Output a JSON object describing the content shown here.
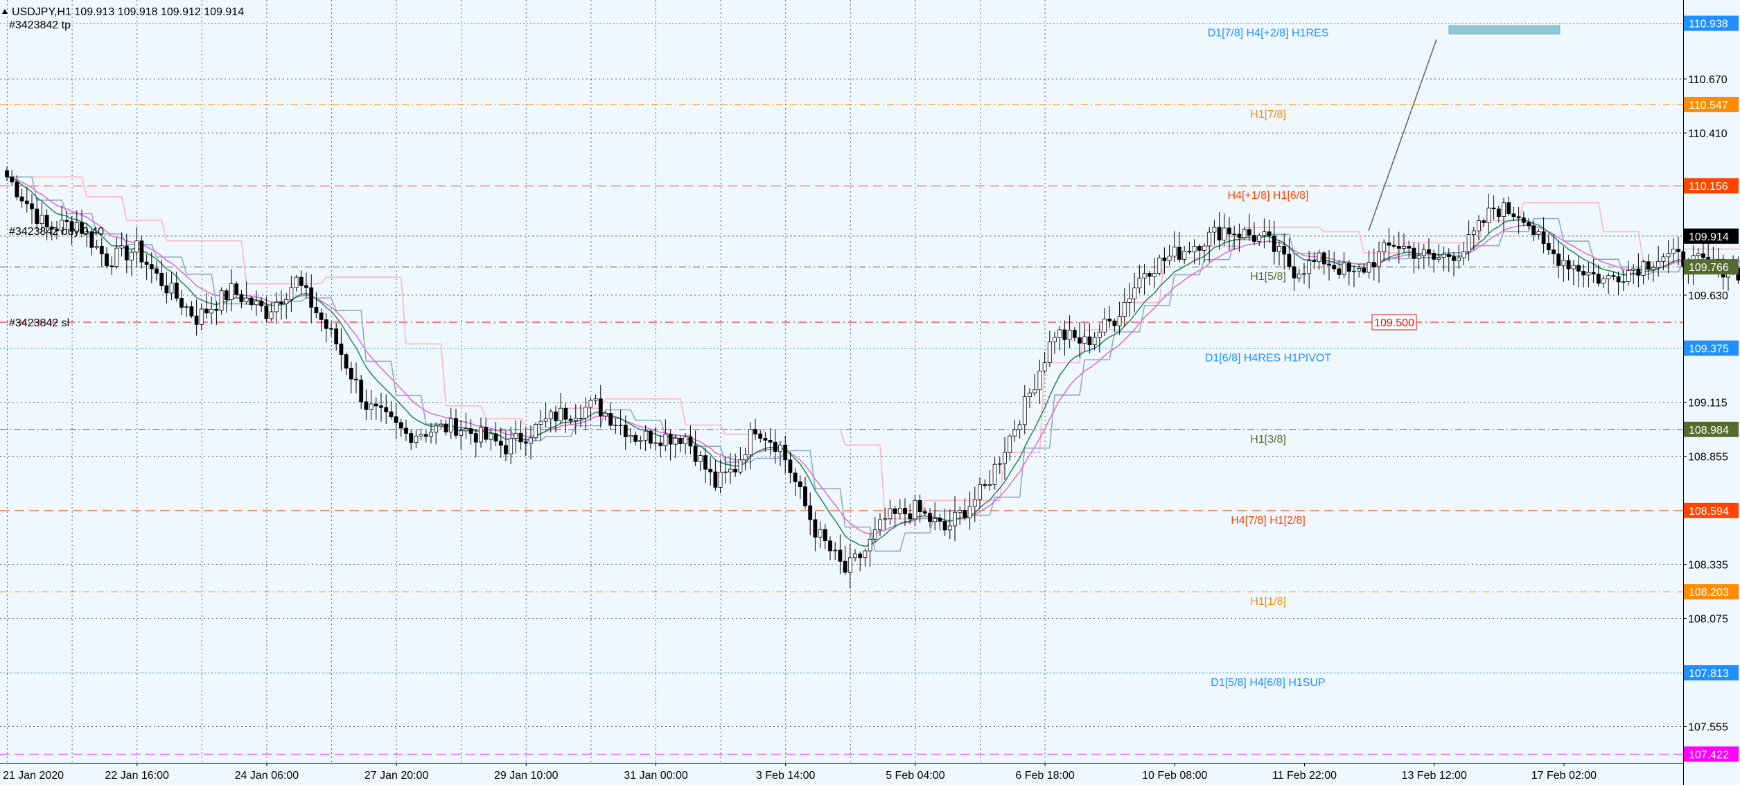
{
  "header": {
    "symbol_line": "USDJPY,H1  109.913 109.918 109.912 109.914",
    "tp_label": "#3423842 tp",
    "buy_label": "#3423842 buy 0.40",
    "sl_label": "#3423842 sl"
  },
  "colors": {
    "background": "#F0F8FF",
    "grid": "#000000",
    "candle": "#000000",
    "dodgerblue": "#1E90FF",
    "orange": "#FF8C00",
    "orangered": "#FF4500",
    "darkolive": "#556B2F",
    "magenta": "#FF00FF",
    "red": "#FF0000",
    "ma_green": "#2E8B57",
    "ma_pink": "#DA70D6",
    "ma_lightpink": "#FFB6C1",
    "ma_steel": "#8FA8C8"
  },
  "chart_data": {
    "type": "candlestick",
    "symbol": "USDJPY",
    "timeframe": "H1",
    "ohlc_now": {
      "open": 109.913,
      "high": 109.918,
      "low": 109.912,
      "close": 109.914
    },
    "ylim": [
      107.38,
      111.05
    ],
    "y_ticks": [
      110.67,
      110.41,
      109.63,
      109.115,
      108.855,
      108.335,
      108.075,
      107.555
    ],
    "x_ticks": [
      "21 Jan 2020",
      "22 Jan 16:00",
      "24 Jan 06:00",
      "27 Jan 20:00",
      "29 Jan 10:00",
      "31 Jan 00:00",
      "3 Feb 14:00",
      "5 Feb 04:00",
      "6 Feb 18:00",
      "10 Feb 08:00",
      "11 Feb 22:00",
      "13 Feb 12:00",
      "17 Feb 02:00"
    ],
    "bars_total": 320,
    "bars_per_tick": 26,
    "levels": [
      {
        "price": 110.938,
        "label": "D1[7/8] H4[+2/8] H1RES",
        "tag": "110.938",
        "color": "#1E90FF",
        "style": "dotted"
      },
      {
        "price": 110.547,
        "label": "H1[7/8]",
        "tag": "110.547",
        "color": "#FF8C00",
        "style": "dashdot"
      },
      {
        "price": 110.156,
        "label": "H4[+1/8] H1[6/8]",
        "tag": "110.156",
        "color": "#FF4500",
        "style": "dashed"
      },
      {
        "price": 109.766,
        "label": "H1[5/8]",
        "tag": "109.766",
        "color": "#556B2F",
        "style": "dashdot"
      },
      {
        "price": 109.375,
        "label": "D1[6/8] H4RES H1PIVOT",
        "tag": "109.375",
        "color": "#1E90FF",
        "style": "dotted"
      },
      {
        "price": 108.984,
        "label": "H1[3/8]",
        "tag": "108.984",
        "color": "#556B2F",
        "style": "dashdot"
      },
      {
        "price": 108.594,
        "label": "H4[7/8] H1[2/8]",
        "tag": "108.594",
        "color": "#FF4500",
        "style": "dashed"
      },
      {
        "price": 108.203,
        "label": "H1[1/8]",
        "tag": "108.203",
        "color": "#FF8C00",
        "style": "dashdot"
      },
      {
        "price": 107.813,
        "label": "D1[5/8] H4[6/8] H1SUP",
        "tag": "107.813",
        "color": "#1E90FF",
        "style": "dotted"
      },
      {
        "price": 107.422,
        "label": "",
        "tag": "107.422",
        "color": "#FF00FF",
        "style": "dashed"
      }
    ],
    "current_price": {
      "price": 109.914,
      "tag": "109.914"
    },
    "sl_price": {
      "price": 109.5,
      "tag": "109.500"
    },
    "close_anchors": [
      [
        0,
        110.2
      ],
      [
        8,
        109.95
      ],
      [
        14,
        109.98
      ],
      [
        20,
        109.8
      ],
      [
        26,
        109.85
      ],
      [
        30,
        109.72
      ],
      [
        38,
        109.52
      ],
      [
        45,
        109.65
      ],
      [
        52,
        109.55
      ],
      [
        58,
        109.7
      ],
      [
        62,
        109.55
      ],
      [
        66,
        109.4
      ],
      [
        72,
        109.1
      ],
      [
        80,
        108.96
      ],
      [
        90,
        109.0
      ],
      [
        100,
        108.9
      ],
      [
        110,
        109.05
      ],
      [
        118,
        109.1
      ],
      [
        126,
        108.95
      ],
      [
        136,
        108.95
      ],
      [
        142,
        108.72
      ],
      [
        146,
        108.8
      ],
      [
        150,
        109.0
      ],
      [
        155,
        108.9
      ],
      [
        162,
        108.5
      ],
      [
        168,
        108.3
      ],
      [
        172,
        108.4
      ],
      [
        176,
        108.55
      ],
      [
        182,
        108.6
      ],
      [
        188,
        108.5
      ],
      [
        196,
        108.7
      ],
      [
        204,
        109.1
      ],
      [
        210,
        109.45
      ],
      [
        216,
        109.4
      ],
      [
        222,
        109.52
      ],
      [
        228,
        109.75
      ],
      [
        236,
        109.85
      ],
      [
        244,
        109.95
      ],
      [
        252,
        109.9
      ],
      [
        258,
        109.75
      ],
      [
        264,
        109.8
      ],
      [
        270,
        109.72
      ],
      [
        278,
        109.88
      ],
      [
        286,
        109.8
      ],
      [
        292,
        109.85
      ],
      [
        298,
        110.05
      ],
      [
        304,
        110.02
      ],
      [
        308,
        109.85
      ],
      [
        312,
        109.8
      ],
      [
        320,
        109.7
      ],
      [
        332,
        109.82
      ],
      [
        340,
        109.78
      ],
      [
        346,
        109.75
      ],
      [
        352,
        109.7
      ],
      [
        358,
        109.82
      ],
      [
        364,
        109.88
      ],
      [
        368,
        109.914
      ]
    ]
  }
}
